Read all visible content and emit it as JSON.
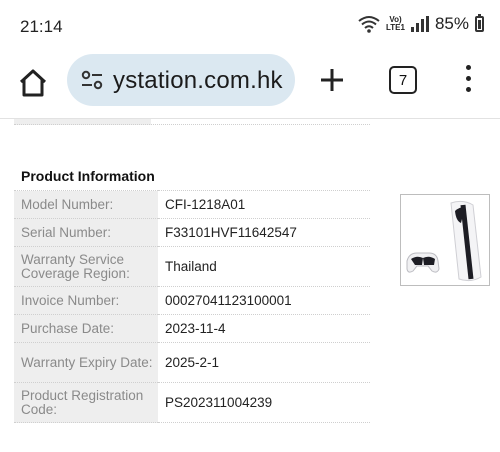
{
  "status_bar": {
    "time": "21:14",
    "network_label_top": "Vo)",
    "network_label_bottom": "LTE1",
    "battery": "85%"
  },
  "browser": {
    "url": "ystation.com.hk",
    "tab_count": "7"
  },
  "product_info": {
    "heading": "Product Information",
    "rows": [
      {
        "label": "Model Number:",
        "value": "CFI-1218A01"
      },
      {
        "label": "Serial Number:",
        "value": "F33101HVF11642547"
      },
      {
        "label": "Warranty Service Coverage Region:",
        "value": "Thailand"
      },
      {
        "label": "Invoice Number:",
        "value": "00027041123100001"
      },
      {
        "label": "Purchase Date:",
        "value": "2023-11-4"
      },
      {
        "label": "Warranty Expiry Date:",
        "value": "2025-2-1"
      },
      {
        "label": "Product Registration Code:",
        "value": "PS202311004239"
      }
    ]
  }
}
